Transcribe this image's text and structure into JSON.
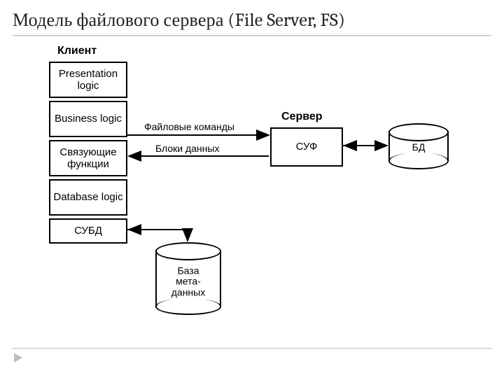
{
  "title": "Модель файлового сервера (File Server, FS)",
  "labels": {
    "client": "Клиент",
    "server": "Сервер"
  },
  "client_stack": [
    "Presentation logic",
    "Business logic",
    "Связующие функции",
    "Database logic",
    "СУБД"
  ],
  "server_box": "СУФ",
  "db_cyl": "БД",
  "meta_cyl": "База\nмета-\nданных",
  "arrows": {
    "to_server": "Файловые команды",
    "from_server": "Блоки данных"
  }
}
